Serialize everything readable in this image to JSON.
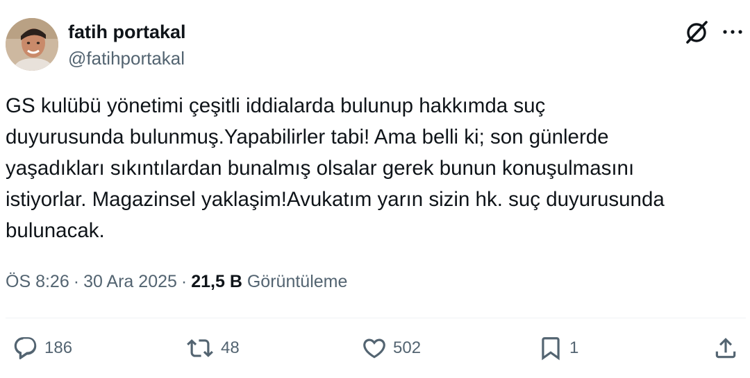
{
  "author": {
    "name": "fatih portakal",
    "handle": "@fatihportakal"
  },
  "tweet": {
    "lines": [
      "GS kulübü yönetimi çeşitli iddialarda bulunup hakkımda suç",
      "duyurusunda bulunmuş.Yapabilirler tabi! Ama belli ki; son günlerde",
      "yaşadıkları sıkıntılardan bunalmış olsalar gerek bunun konuşulmasını",
      "istiyorlar. Magazinsel yaklaşim!Avukatım yarın sizin hk. suç duyurusunda",
      "bulunacak."
    ]
  },
  "meta": {
    "time": "ÖS 8:26",
    "separator": "·",
    "date": "30 Ara 2025",
    "views_count": "21,5 B",
    "views_label": "Görüntüleme"
  },
  "actions": {
    "replies": "186",
    "retweets": "48",
    "likes": "502",
    "bookmarks": "1"
  },
  "icons": {
    "grok": "grok-icon",
    "more": "more-icon",
    "reply": "reply-icon",
    "retweet": "retweet-icon",
    "like": "heart-icon",
    "bookmark": "bookmark-icon",
    "share": "share-icon"
  },
  "colors": {
    "text": "#0f1419",
    "secondary": "#536471",
    "divider": "#eff3f4"
  }
}
